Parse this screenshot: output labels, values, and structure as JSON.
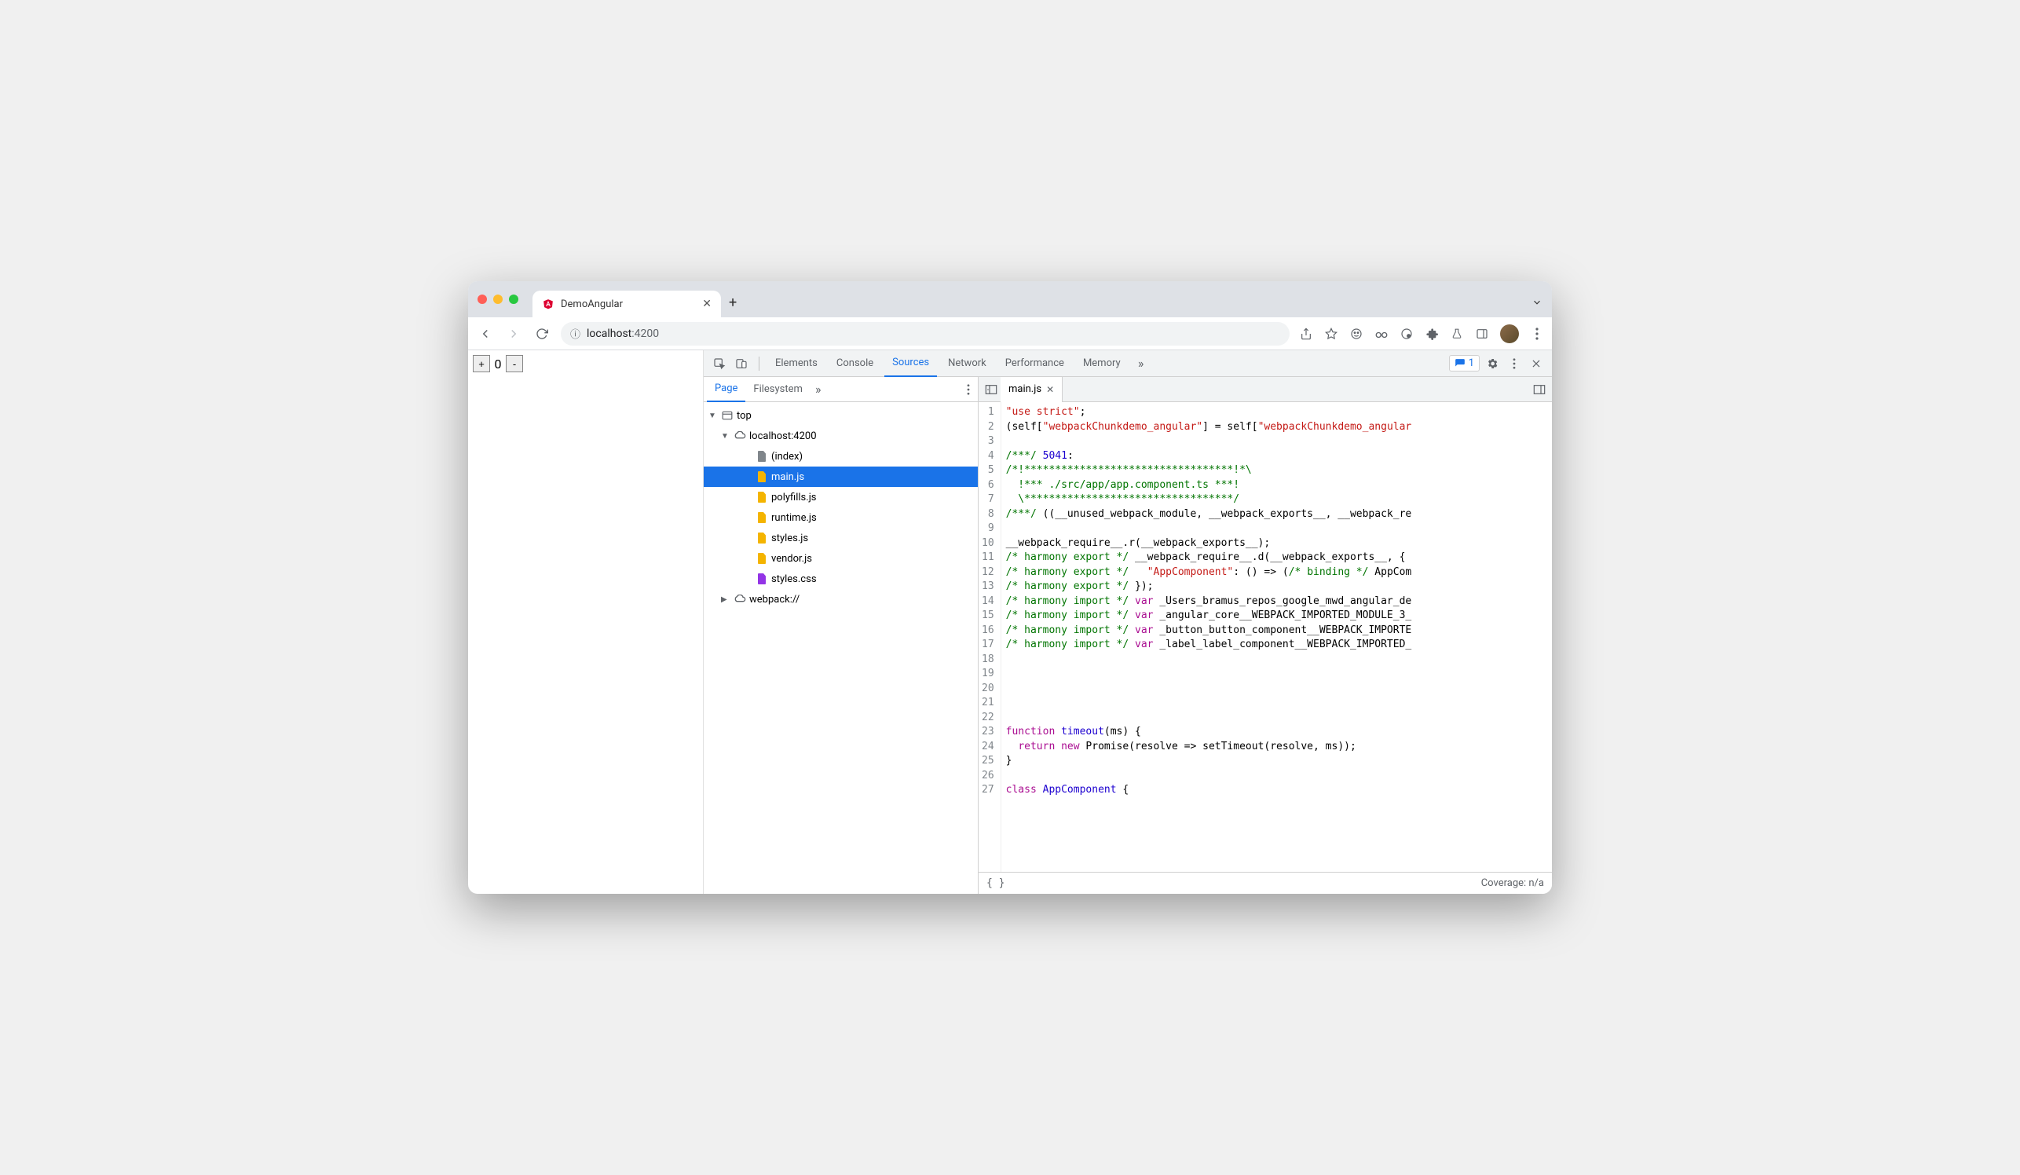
{
  "browser": {
    "tab_title": "DemoAngular",
    "url_display_host": "localhost",
    "url_display_port": ":4200"
  },
  "page_content": {
    "counter_value": "0"
  },
  "devtools": {
    "tabs": [
      "Elements",
      "Console",
      "Sources",
      "Network",
      "Performance",
      "Memory"
    ],
    "active_tab": "Sources",
    "issue_count": "1",
    "navigator": {
      "tabs": [
        "Page",
        "Filesystem"
      ],
      "active": "Page",
      "tree": {
        "top": "top",
        "origin": "localhost:4200",
        "files": [
          {
            "name": "(index)",
            "type": "doc"
          },
          {
            "name": "main.js",
            "type": "js",
            "selected": true
          },
          {
            "name": "polyfills.js",
            "type": "js"
          },
          {
            "name": "runtime.js",
            "type": "js"
          },
          {
            "name": "styles.js",
            "type": "js"
          },
          {
            "name": "vendor.js",
            "type": "js"
          },
          {
            "name": "styles.css",
            "type": "css"
          }
        ],
        "webpack": "webpack://"
      }
    },
    "editor": {
      "open_file": "main.js",
      "lines": [
        [
          {
            "t": "\"use strict\"",
            "c": "str"
          },
          {
            "t": ";"
          }
        ],
        [
          {
            "t": "(self["
          },
          {
            "t": "\"webpackChunkdemo_angular\"",
            "c": "str"
          },
          {
            "t": "] = self["
          },
          {
            "t": "\"webpackChunkdemo_angular",
            "c": "str"
          }
        ],
        [],
        [
          {
            "t": "/***/",
            "c": "com"
          },
          {
            "t": " "
          },
          {
            "t": "5041",
            "c": "num"
          },
          {
            "t": ":"
          }
        ],
        [
          {
            "t": "/*!**********************************!*\\",
            "c": "com"
          }
        ],
        [
          {
            "t": "  !*** ./src/app/app.component.ts ***!",
            "c": "com"
          }
        ],
        [
          {
            "t": "  \\**********************************/",
            "c": "com"
          }
        ],
        [
          {
            "t": "/***/",
            "c": "com"
          },
          {
            "t": " ((__unused_webpack_module, __webpack_exports__, __webpack_re"
          }
        ],
        [],
        [
          {
            "t": "__webpack_require__.r(__webpack_exports__);"
          }
        ],
        [
          {
            "t": "/* harmony export */",
            "c": "com"
          },
          {
            "t": " __webpack_require__.d(__webpack_exports__, {"
          }
        ],
        [
          {
            "t": "/* harmony export */",
            "c": "com"
          },
          {
            "t": "   "
          },
          {
            "t": "\"AppComponent\"",
            "c": "str"
          },
          {
            "t": ": () => ("
          },
          {
            "t": "/* binding */",
            "c": "com"
          },
          {
            "t": " AppCom"
          }
        ],
        [
          {
            "t": "/* harmony export */",
            "c": "com"
          },
          {
            "t": " });"
          }
        ],
        [
          {
            "t": "/* harmony import */",
            "c": "com"
          },
          {
            "t": " "
          },
          {
            "t": "var",
            "c": "kw"
          },
          {
            "t": " _Users_bramus_repos_google_mwd_angular_de"
          }
        ],
        [
          {
            "t": "/* harmony import */",
            "c": "com"
          },
          {
            "t": " "
          },
          {
            "t": "var",
            "c": "kw"
          },
          {
            "t": " _angular_core__WEBPACK_IMPORTED_MODULE_3_"
          }
        ],
        [
          {
            "t": "/* harmony import */",
            "c": "com"
          },
          {
            "t": " "
          },
          {
            "t": "var",
            "c": "kw"
          },
          {
            "t": " _button_button_component__WEBPACK_IMPORTE"
          }
        ],
        [
          {
            "t": "/* harmony import */",
            "c": "com"
          },
          {
            "t": " "
          },
          {
            "t": "var",
            "c": "kw"
          },
          {
            "t": " _label_label_component__WEBPACK_IMPORTED_"
          }
        ],
        [],
        [],
        [],
        [],
        [],
        [
          {
            "t": "function",
            "c": "kw"
          },
          {
            "t": " "
          },
          {
            "t": "timeout",
            "c": "fn"
          },
          {
            "t": "(ms) {"
          }
        ],
        [
          {
            "t": "  "
          },
          {
            "t": "return",
            "c": "kw"
          },
          {
            "t": " "
          },
          {
            "t": "new",
            "c": "kw"
          },
          {
            "t": " Promise(resolve => setTimeout(resolve, ms));"
          }
        ],
        [
          {
            "t": "}"
          }
        ],
        [],
        [
          {
            "t": "class",
            "c": "kw"
          },
          {
            "t": " "
          },
          {
            "t": "AppComponent",
            "c": "fn"
          },
          {
            "t": " {"
          }
        ]
      ]
    },
    "status": {
      "coverage": "Coverage: n/a"
    }
  }
}
